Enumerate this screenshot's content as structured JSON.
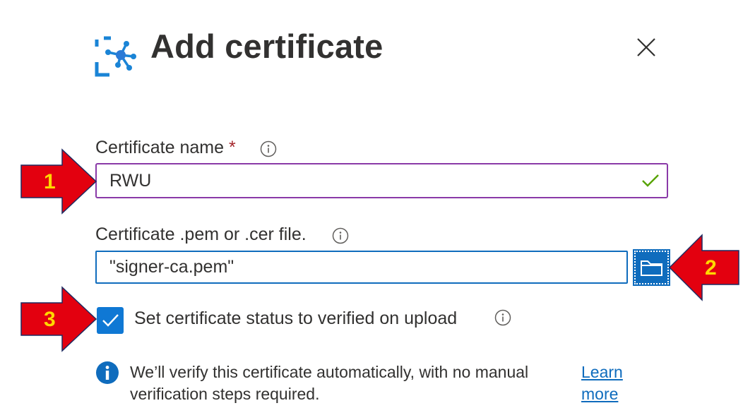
{
  "header": {
    "title": "Add certificate",
    "icon": "iot-hub-icon",
    "close_icon": "close-icon"
  },
  "form": {
    "name_label": "Certificate name",
    "required_mark": "*",
    "name_value": "RWU",
    "file_label": "Certificate .pem or .cer file.",
    "file_value": "\"signer-ca.pem\"",
    "checkbox_label": "Set certificate status to verified on upload",
    "checkbox_checked": true
  },
  "info": {
    "message": "We’ll verify this certificate automatically, with no manual verification steps required.",
    "learn_more": "Learn more"
  },
  "annotations": {
    "one": "1",
    "two": "2",
    "three": "3"
  },
  "colors": {
    "accent": "#0f6cbd",
    "field_focus": "#8a3aa8",
    "required": "#a4262c",
    "valid": "#57a300",
    "annotation_arrow": "#e3000f",
    "annotation_text": "#ffd800"
  }
}
